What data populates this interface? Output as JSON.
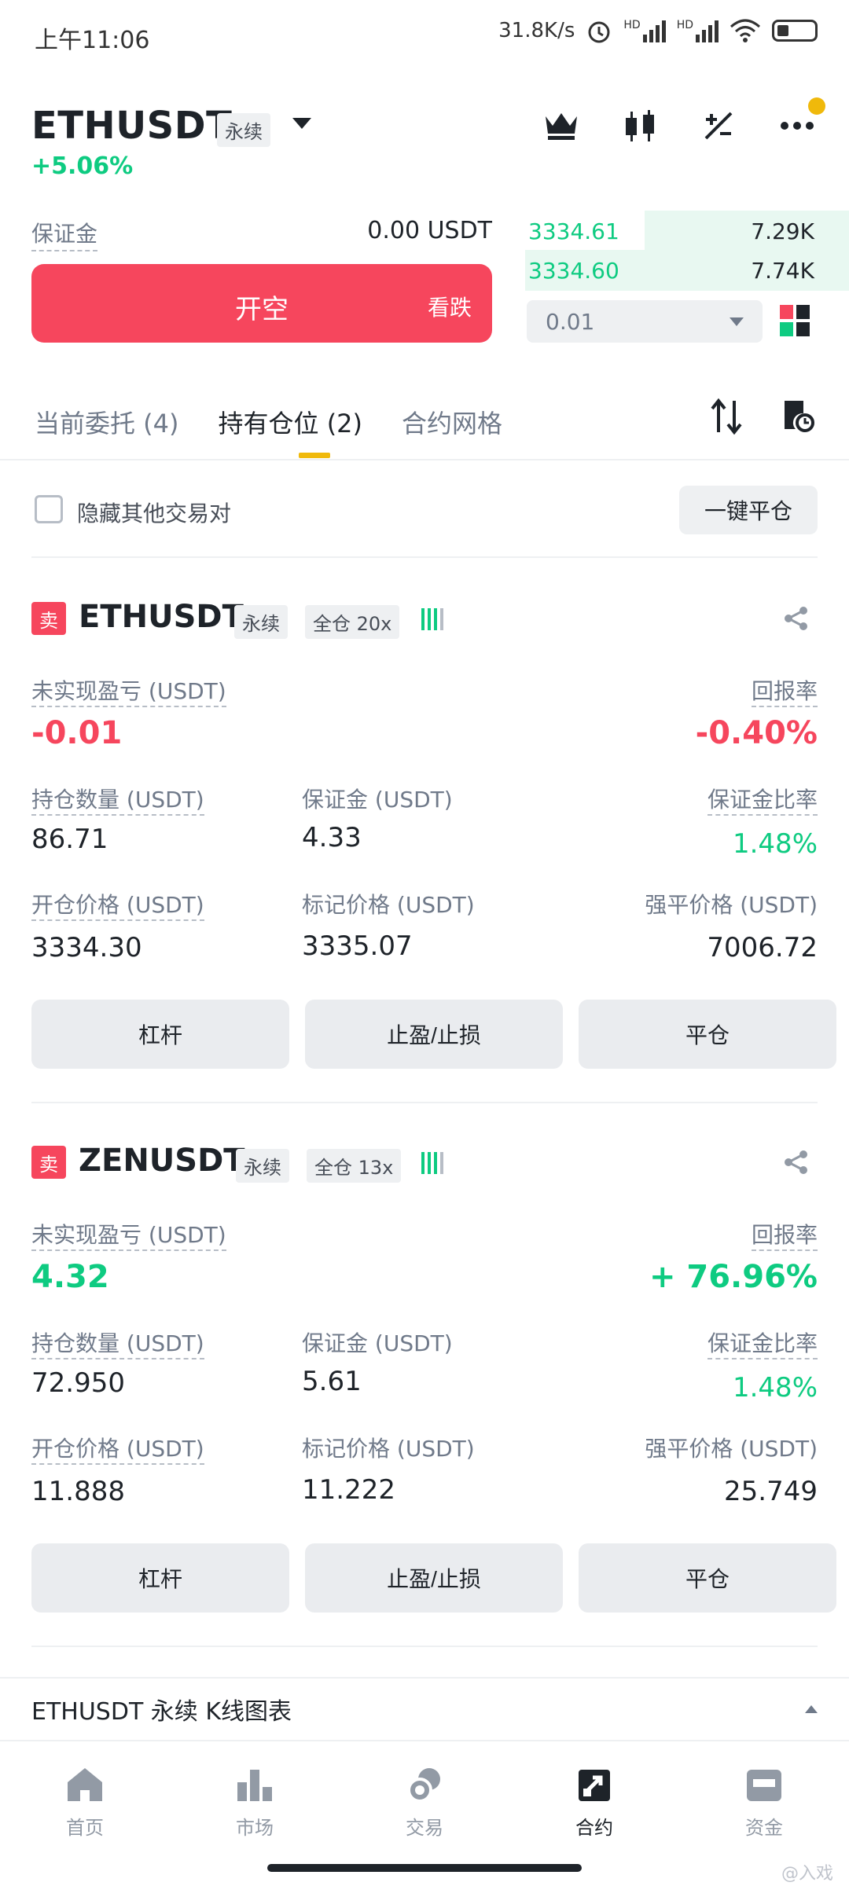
{
  "status_bar": {
    "time": "上午11:06",
    "net_speed": "31.8K/s",
    "signal1": "HD",
    "signal2": "HD",
    "battery": "48"
  },
  "header": {
    "symbol": "ETHUSDT",
    "contract_type": "永续",
    "change_pct": "+5.06%"
  },
  "order_panel": {
    "margin_label": "保证金",
    "margin_value": "0.00 USDT",
    "open_short_label": "开空",
    "bearish_label": "看跌",
    "order_book": [
      {
        "price": "3334.61",
        "qty": "7.29K"
      },
      {
        "price": "3334.60",
        "qty": "7.74K"
      }
    ],
    "qty_select": "0.01"
  },
  "tabs": [
    {
      "label": "当前委托 (4)"
    },
    {
      "label": "持有仓位 (2)"
    },
    {
      "label": "合约网格"
    }
  ],
  "hide_pairs_label": "隐藏其他交易对",
  "close_all_label": "一键平仓",
  "positions": [
    {
      "side": "卖",
      "symbol": "ETHUSDT",
      "type": "永续",
      "margin_mode": "全仓 20x",
      "unrealized_label": "未实现盈亏 (USDT)",
      "unrealized": "-0.01",
      "roe_label": "回报率",
      "roe": "-0.40%",
      "size_label": "持仓数量 (USDT)",
      "size": "86.71",
      "margin_label": "保证金 (USDT)",
      "margin": "4.33",
      "margin_ratio_label": "保证金比率",
      "margin_ratio": "1.48%",
      "entry_label": "开仓价格 (USDT)",
      "entry": "3334.30",
      "mark_label": "标记价格 (USDT)",
      "mark": "3335.07",
      "liq_label": "强平价格 (USDT)",
      "liq": "7006.72",
      "btn_leverage": "杠杆",
      "btn_tpsl": "止盈/止损",
      "btn_close": "平仓"
    },
    {
      "side": "卖",
      "symbol": "ZENUSDT",
      "type": "永续",
      "margin_mode": "全仓 13x",
      "unrealized_label": "未实现盈亏 (USDT)",
      "unrealized": "4.32",
      "roe_label": "回报率",
      "roe": "+ 76.96%",
      "size_label": "持仓数量 (USDT)",
      "size": "72.950",
      "margin_label": "保证金 (USDT)",
      "margin": "5.61",
      "margin_ratio_label": "保证金比率",
      "margin_ratio": "1.48%",
      "entry_label": "开仓价格 (USDT)",
      "entry": "11.888",
      "mark_label": "标记价格 (USDT)",
      "mark": "11.222",
      "liq_label": "强平价格 (USDT)",
      "liq": "25.749",
      "btn_leverage": "杠杆",
      "btn_tpsl": "止盈/止损",
      "btn_close": "平仓"
    }
  ],
  "chart_bar_label": "ETHUSDT 永续 K线图表",
  "nav": [
    {
      "label": "首页",
      "icon": "home-icon"
    },
    {
      "label": "市场",
      "icon": "market-icon"
    },
    {
      "label": "交易",
      "icon": "trade-icon"
    },
    {
      "label": "合约",
      "icon": "futures-icon"
    },
    {
      "label": "资金",
      "icon": "wallet-icon"
    }
  ],
  "watermark": "@入戏",
  "colors": {
    "red": "#f6465d",
    "green": "#0ecb81",
    "accent": "#f0b90b",
    "text": "#1e2329",
    "muted": "#707a8a"
  }
}
